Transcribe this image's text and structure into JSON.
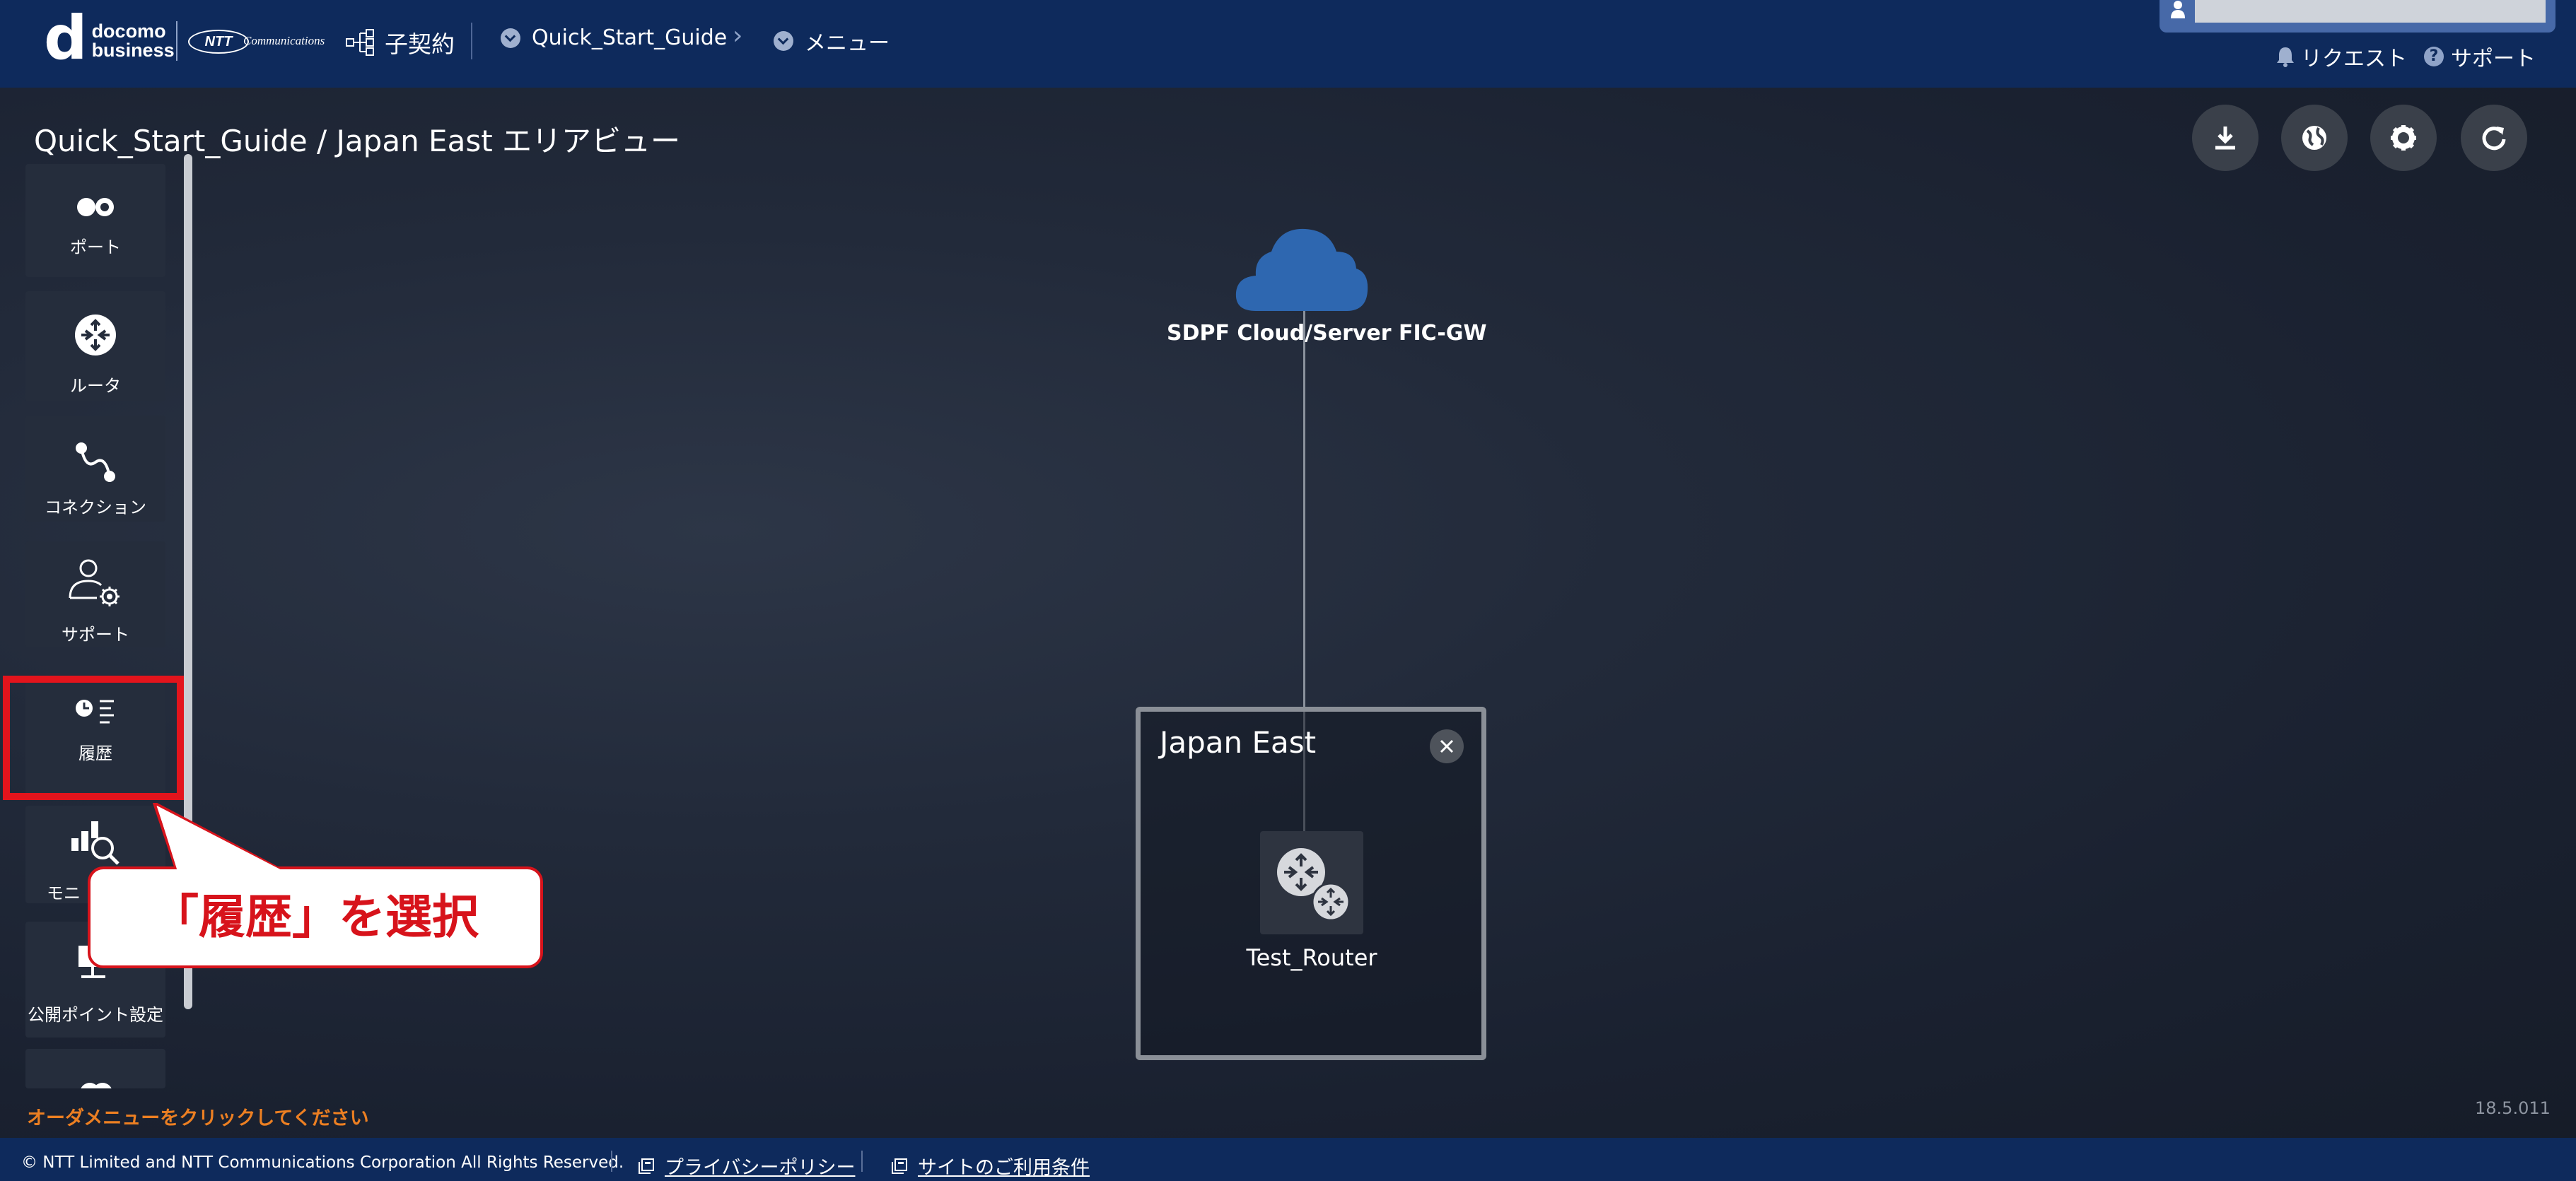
{
  "header": {
    "brand_line1": "docomo",
    "brand_line2": "business",
    "partner_logo_text": "NTT",
    "partner_logo_sub": "Communications",
    "contract_label": "子契約",
    "breadcrumb": [
      {
        "label": "Quick_Start_Guide"
      },
      {
        "label": "メニュー"
      }
    ],
    "request_label": "リクエスト",
    "support_label": "サポート"
  },
  "page": {
    "title": "Quick_Start_Guide / Japan East エリアビュー"
  },
  "sidebar": {
    "items": [
      {
        "label": "ポート",
        "icon": "port-icon"
      },
      {
        "label": "ルータ",
        "icon": "router-icon"
      },
      {
        "label": "コネクション",
        "icon": "connection-icon"
      },
      {
        "label": "サポート",
        "icon": "support-user-icon"
      },
      {
        "label": "履歴",
        "icon": "history-icon",
        "highlighted": true
      },
      {
        "label": "モニ",
        "icon": "monitor-icon"
      },
      {
        "label": "公開ポイント設定",
        "icon": "public-point-icon"
      }
    ]
  },
  "annotation": {
    "callout_text": "「履歴」を選択",
    "highlight_color": "#e3141c"
  },
  "toolbar": {
    "buttons": [
      "download-icon",
      "globe-icon",
      "gear-icon",
      "refresh-icon"
    ]
  },
  "topology": {
    "cloud_label": "SDPF Cloud/Server FIC-GW",
    "area_title": "Japan East",
    "router_label": "Test_Router"
  },
  "status": {
    "order_message": "オーダメニューをクリックしてください",
    "version": "18.5.011"
  },
  "footer": {
    "copyright": "© NTT Limited and NTT Communications Corporation All Rights Reserved.",
    "privacy_label": "プライバシーポリシー",
    "terms_label": "サイトのご利用条件"
  },
  "colors": {
    "header_bg": "#0e2a5c",
    "canvas_bg": "#1b2333",
    "accent_red": "#e3141c",
    "cloud_blue": "#2e67b0",
    "order_orange": "#ec7f22"
  }
}
